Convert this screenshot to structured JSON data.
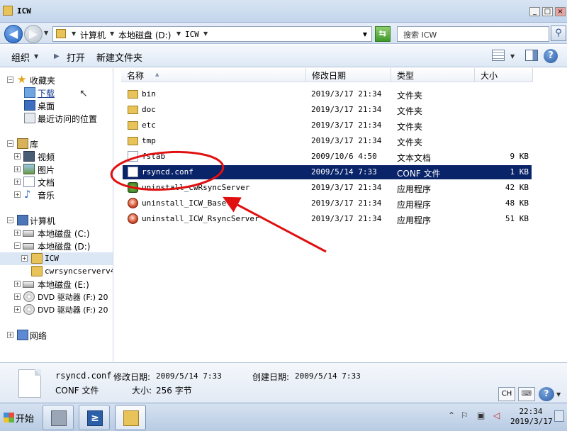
{
  "window": {
    "title": "ICW",
    "buttons": {
      "minimize": "_",
      "maximize": "□",
      "close": "×"
    }
  },
  "address": {
    "crumbs": [
      "计算机",
      "本地磁盘 (D:)",
      "ICW"
    ],
    "search_placeholder": "搜索 ICW"
  },
  "toolbar": {
    "organize": "组织",
    "open": "打开",
    "new_folder": "新建文件夹"
  },
  "nav": {
    "favorites": "收藏夹",
    "downloads": "下载",
    "desktop": "桌面",
    "recent": "最近访问的位置",
    "libraries": "库",
    "videos": "视频",
    "pictures": "图片",
    "documents": "文档",
    "music": "音乐",
    "computer": "计算机",
    "drive_c": "本地磁盘 (C:)",
    "drive_d": "本地磁盘 (D:)",
    "icw": "ICW",
    "cwrsync": "cwrsyncserverv4.",
    "drive_e": "本地磁盘 (E:)",
    "dvd_f1": "DVD 驱动器 (F:) 20",
    "dvd_f2": "DVD 驱动器 (F:) 20",
    "network": "网络"
  },
  "columns": {
    "name": "名称",
    "modified": "修改日期",
    "type": "类型",
    "size": "大小"
  },
  "files": [
    {
      "name": "bin",
      "date": "2019/3/17 21:34",
      "type": "文件夹",
      "size": "",
      "icon": "folder-icon"
    },
    {
      "name": "doc",
      "date": "2019/3/17 21:34",
      "type": "文件夹",
      "size": "",
      "icon": "folder-icon"
    },
    {
      "name": "etc",
      "date": "2019/3/17 21:34",
      "type": "文件夹",
      "size": "",
      "icon": "folder-icon"
    },
    {
      "name": "tmp",
      "date": "2019/3/17 21:34",
      "type": "文件夹",
      "size": "",
      "icon": "folder-icon"
    },
    {
      "name": "fstab",
      "date": "2009/10/6 4:50",
      "type": "文本文档",
      "size": "9 KB",
      "icon": "text-file-icon"
    },
    {
      "name": "rsyncd.conf",
      "date": "2009/5/14 7:33",
      "type": "CONF 文件",
      "size": "1 KB",
      "icon": "conf-file-icon"
    },
    {
      "name": "uninstall_cwRsyncServer",
      "date": "2019/3/17 21:34",
      "type": "应用程序",
      "size": "42 KB",
      "icon": "cwrsync-exe-icon"
    },
    {
      "name": "uninstall_ICW_Base",
      "date": "2019/3/17 21:34",
      "type": "应用程序",
      "size": "48 KB",
      "icon": "exe-icon"
    },
    {
      "name": "uninstall_ICW_RsyncServer",
      "date": "2019/3/17 21:34",
      "type": "应用程序",
      "size": "51 KB",
      "icon": "exe-icon"
    }
  ],
  "details": {
    "filename": "rsyncd.conf",
    "modified_label": "修改日期:",
    "modified_value": "2009/5/14 7:33",
    "created_label": "创建日期:",
    "created_value": "2009/5/14 7:33",
    "type": "CONF 文件",
    "size_label": "大小:",
    "size_value": "256 字节",
    "ime": "CH"
  },
  "taskbar": {
    "start": "开始",
    "time": "22:34",
    "date": "2019/3/17"
  },
  "colors": {
    "selection": "#0a246a",
    "annotation": "#e01010"
  }
}
